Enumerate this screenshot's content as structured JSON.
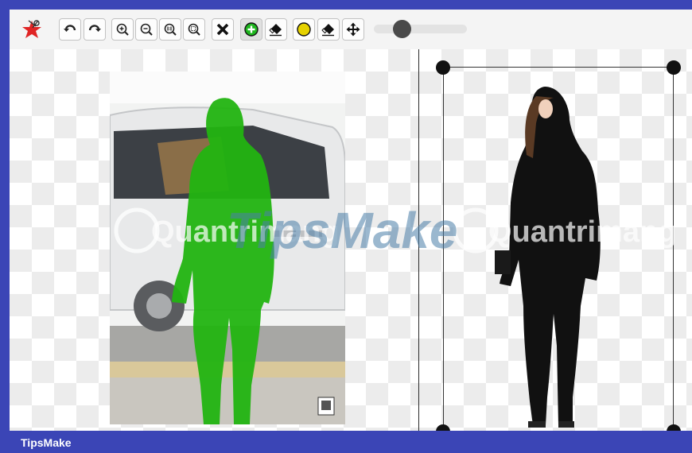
{
  "toolbar": {
    "tools": [
      {
        "name": "undo-icon"
      },
      {
        "name": "redo-icon"
      },
      {
        "name": "zoom-in-icon"
      },
      {
        "name": "zoom-out-icon"
      },
      {
        "name": "zoom-actual-size-icon"
      },
      {
        "name": "zoom-fit-icon"
      },
      {
        "name": "clear-icon"
      },
      {
        "name": "keep-brush-icon"
      },
      {
        "name": "eraser-icon"
      },
      {
        "name": "remove-brush-icon"
      },
      {
        "name": "eraser-icon"
      },
      {
        "name": "pan-icon"
      }
    ],
    "brush_size_fraction": 0.3
  },
  "colors": {
    "frame": "#3b45b6",
    "keep_marker": "#1db51d",
    "remove_marker": "#e6d200",
    "mask_overlay": "#22b411"
  },
  "watermark": {
    "text_left": "Quantrimang",
    "text_center": "TipsMake",
    "text_right": "Quantrimang"
  },
  "footer": {
    "brand": "TipsMake"
  }
}
